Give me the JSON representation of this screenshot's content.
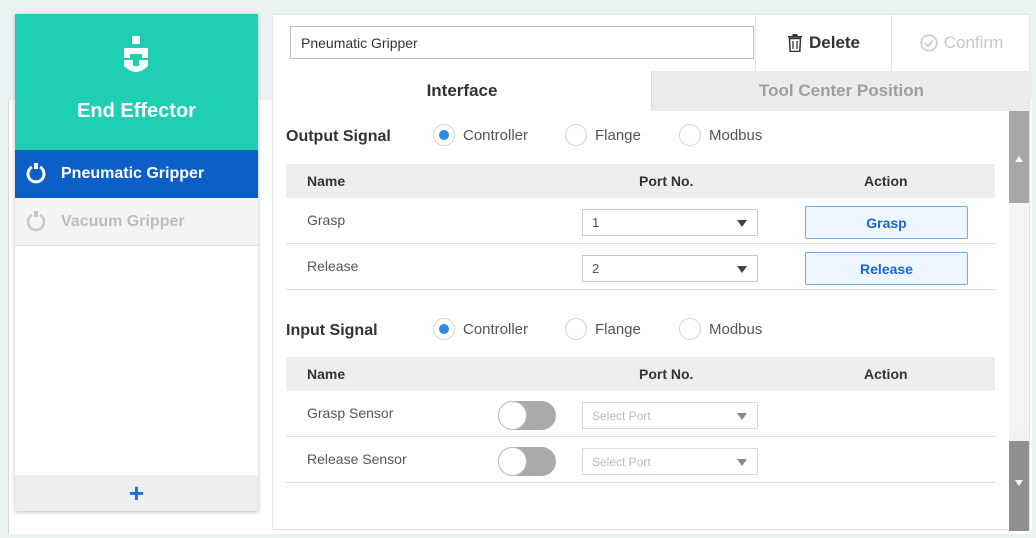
{
  "sidebar": {
    "title": "End Effector",
    "items": [
      {
        "label": "Pneumatic Gripper",
        "active": true
      },
      {
        "label": "Vacuum Gripper",
        "active": false
      }
    ],
    "add_label": "+"
  },
  "header": {
    "name_value": "Pneumatic Gripper",
    "delete_label": "Delete",
    "confirm_label": "Confirm"
  },
  "tabs": [
    {
      "label": "Interface",
      "active": true
    },
    {
      "label": "Tool Center Position",
      "active": false
    }
  ],
  "output": {
    "label": "Output Signal",
    "options": [
      "Controller",
      "Flange",
      "Modbus"
    ],
    "selected": "Controller",
    "columns": [
      "Name",
      "Port No.",
      "Action"
    ],
    "rows": [
      {
        "name": "Grasp",
        "port": "1",
        "action": "Grasp"
      },
      {
        "name": "Release",
        "port": "2",
        "action": "Release"
      }
    ]
  },
  "input": {
    "label": "Input Signal",
    "options": [
      "Controller",
      "Flange",
      "Modbus"
    ],
    "selected": "Controller",
    "columns": [
      "Name",
      "Port No.",
      "Action"
    ],
    "rows": [
      {
        "name": "Grasp Sensor",
        "port_placeholder": "Select Port",
        "enabled": false
      },
      {
        "name": "Release Sensor",
        "port_placeholder": "Select Port",
        "enabled": false
      }
    ]
  },
  "colors": {
    "accent": "#1fcfb3",
    "active_item": "#0d5fc8",
    "radio_on": "#2d8ae8",
    "action_text": "#1b66c9"
  },
  "icons": {
    "header": "end-effector-icon",
    "gripper": "gripper-icon",
    "delete": "trash-icon",
    "confirm": "check-circle-icon",
    "add": "plus-icon"
  }
}
